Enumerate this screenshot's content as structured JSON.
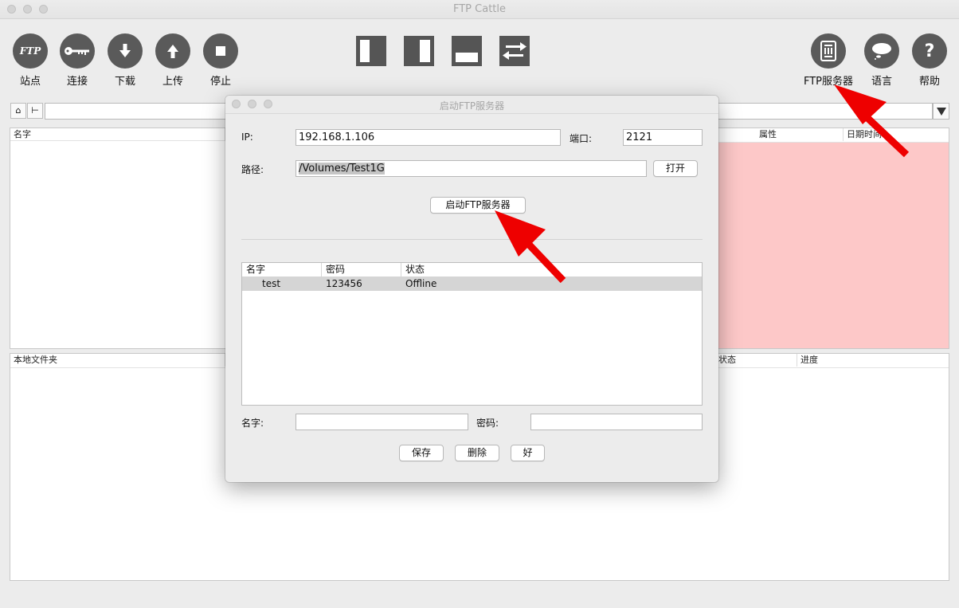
{
  "app": {
    "title": "FTP Cattle"
  },
  "toolbar": {
    "site": "站点",
    "connect": "连接",
    "download": "下载",
    "upload": "上传",
    "stop": "停止",
    "ftp_server": "FTP服务器",
    "language": "语言",
    "help": "帮助",
    "ftp_glyph": "FTP"
  },
  "remote_list": {
    "col_name": "名字",
    "col_attr": "属性",
    "col_datetime": "日期时间"
  },
  "transfer_list": {
    "col_local_folder": "本地文件夹",
    "col_status": "状态",
    "col_progress": "进度"
  },
  "dialog": {
    "title": "启动FTP服务器",
    "ip_label": "IP:",
    "ip_value": "192.168.1.106",
    "port_label": "端口:",
    "port_value": "2121",
    "path_label": "路径:",
    "path_value": "/Volumes/Test1G",
    "open_button": "打开",
    "start_button": "启动FTP服务器",
    "table": {
      "headers": [
        "名字",
        "密码",
        "状态"
      ],
      "rows": [
        {
          "name": "test",
          "password": "123456",
          "status": "Offline"
        }
      ]
    },
    "name_label": "名字:",
    "password_label": "密码:",
    "save_button": "保存",
    "delete_button": "删除",
    "ok_button": "好"
  },
  "colors": {
    "remote_pane_bg": "#fdc8c8",
    "arrow": "#ff0000",
    "toolbar_icon": "#5a5a5a"
  }
}
